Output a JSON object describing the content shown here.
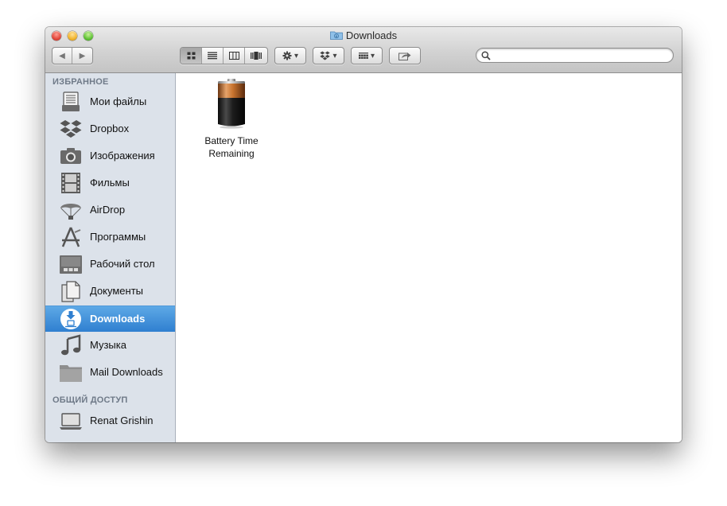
{
  "window": {
    "title": "Downloads"
  },
  "toolbar": {
    "nav": {
      "back": "◀",
      "forward": "▶"
    },
    "view_modes": [
      "icon-view",
      "list-view",
      "column-view",
      "coverflow-view"
    ],
    "active_view": "icon-view",
    "action_menu": "▾",
    "dropbox_menu": "▾",
    "arrange_menu": "▾"
  },
  "search": {
    "value": "",
    "placeholder": ""
  },
  "sidebar": {
    "favorites_header": "ИЗБРАННОЕ",
    "favorites": [
      {
        "label": "Мои файлы",
        "icon": "all-my-files-icon"
      },
      {
        "label": "Dropbox",
        "icon": "dropbox-icon"
      },
      {
        "label": "Изображения",
        "icon": "camera-icon"
      },
      {
        "label": "Фильмы",
        "icon": "film-icon"
      },
      {
        "label": "AirDrop",
        "icon": "airdrop-icon"
      },
      {
        "label": "Программы",
        "icon": "applications-icon"
      },
      {
        "label": "Рабочий стол",
        "icon": "desktop-icon"
      },
      {
        "label": "Документы",
        "icon": "documents-icon"
      },
      {
        "label": "Downloads",
        "icon": "downloads-icon",
        "selected": true
      },
      {
        "label": "Музыка",
        "icon": "music-icon"
      },
      {
        "label": "Mail Downloads",
        "icon": "folder-icon"
      }
    ],
    "shared_header": "ОБЩИЙ ДОСТУП",
    "shared": [
      {
        "label": "Renat Grishin",
        "icon": "computer-icon"
      }
    ]
  },
  "files": [
    {
      "name_line1": "Battery Time",
      "name_line2": "Remaining",
      "icon": "battery-icon"
    }
  ],
  "colors": {
    "sidebar_bg": "#dce2ea",
    "selection": "#2f7fd0",
    "battery_copper": "#c8742f"
  }
}
